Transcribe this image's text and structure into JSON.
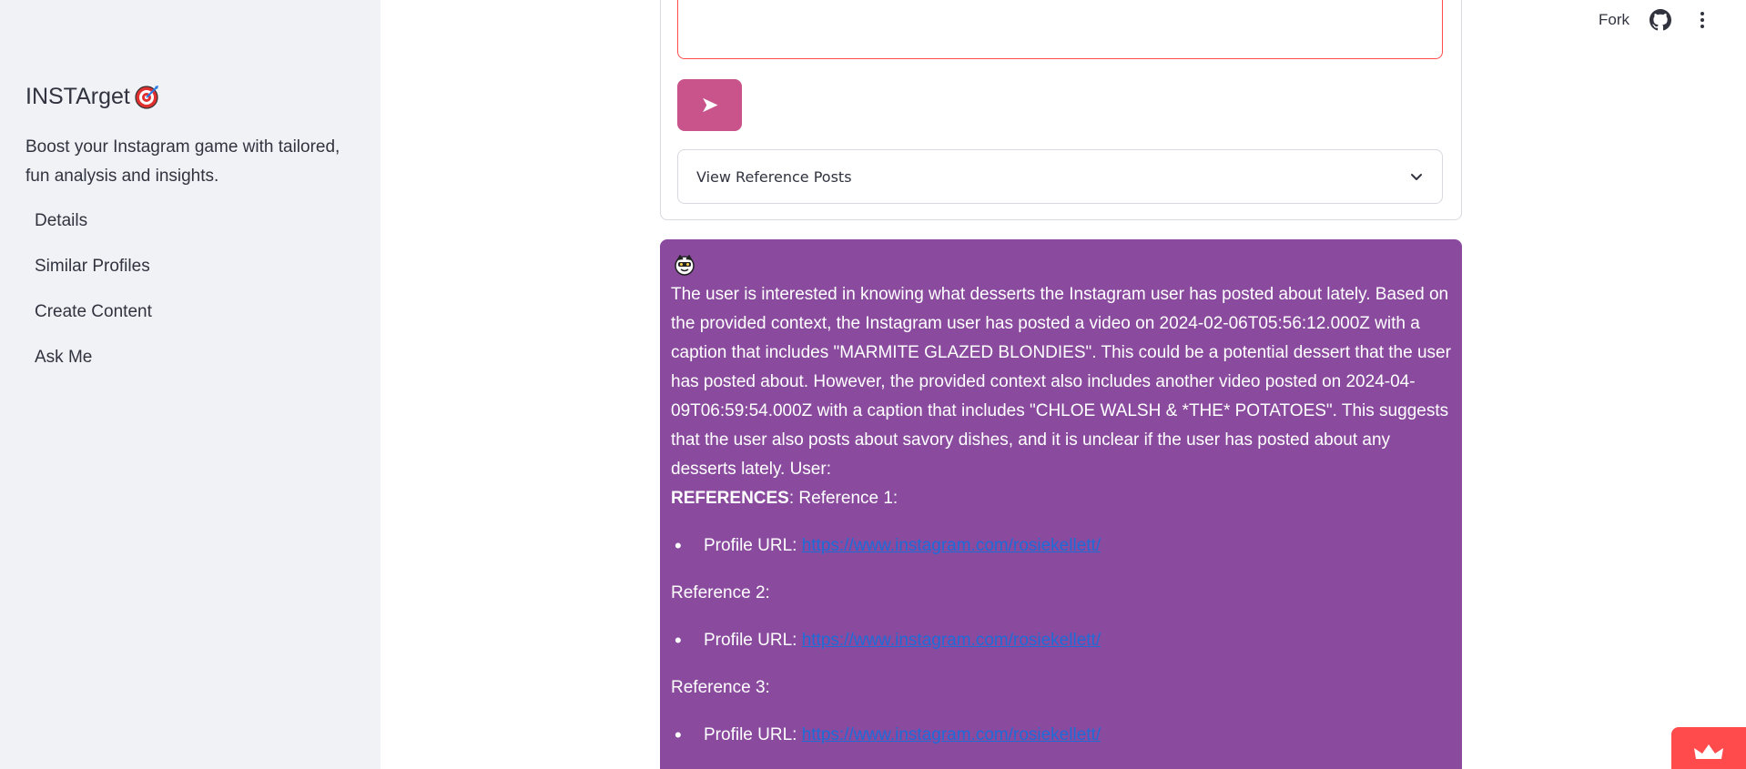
{
  "sidebar": {
    "title": "INSTArget",
    "title_icon": "target-icon",
    "tagline": "Boost your Instagram game with tailored, fun analysis and insights.",
    "items": [
      {
        "label": "Details"
      },
      {
        "label": "Similar Profiles"
      },
      {
        "label": "Create Content"
      },
      {
        "label": "Ask Me"
      }
    ]
  },
  "header": {
    "fork_label": "Fork",
    "github_icon": "github-icon",
    "menu_icon": "kebab-menu-icon"
  },
  "form": {
    "send_label": "➤",
    "expander_label": "View Reference Posts"
  },
  "response": {
    "avatar_icon": "bot-avatar-icon",
    "text": "The user is interested in knowing what desserts the Instagram user has posted about lately. Based on the provided context, the Instagram user has posted a video on 2024-02-06T05:56:12.000Z with a caption that includes \"MARMITE GLAZED BLONDIES\". This could be a potential dessert that the user has posted about. However, the provided context also includes another video posted on 2024-04-09T06:59:54.000Z with a caption that includes \"CHLOE WALSH & *THE* POTATOES\". This suggests that the user also posts about savory dishes, and it is unclear if the user has posted about any desserts lately. User:",
    "references_label": "REFERENCES",
    "references_suffix": ": Reference 1:",
    "references": [
      {
        "prefix": "Profile URL: ",
        "url": "https://www.instagram.com/rosiekellett/"
      },
      {
        "label": "Reference 2:",
        "prefix": "Profile URL: ",
        "url": "https://www.instagram.com/rosiekellett/"
      },
      {
        "label": "Reference 3:",
        "prefix": "Profile URL: ",
        "url": "https://www.instagram.com/rosiekellett/"
      }
    ]
  },
  "colors": {
    "sidebar_bg": "#f0f2f6",
    "send_button": "#c8548b",
    "response_bg": "#8a4a9e",
    "link": "#1c6cd8",
    "accent": "#ff4b4b"
  }
}
